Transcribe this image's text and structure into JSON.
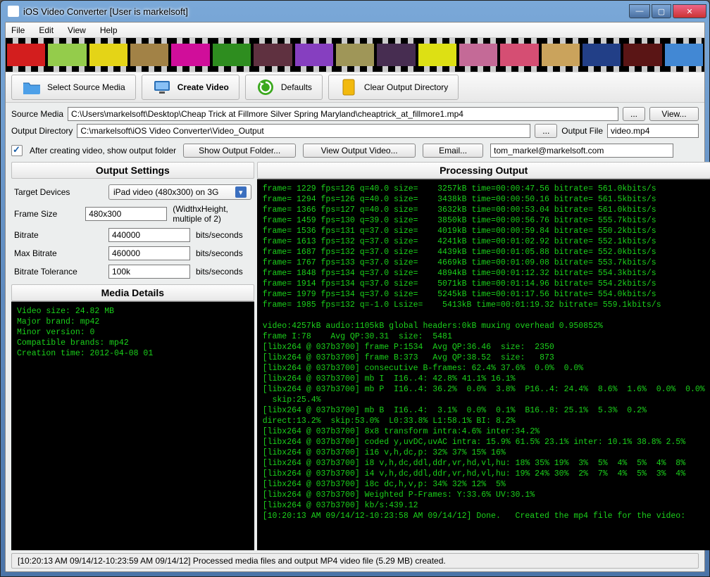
{
  "window": {
    "title": "iOS Video Converter [User is markelsoft]"
  },
  "menu": {
    "file": "File",
    "edit": "Edit",
    "view": "View",
    "help": "Help"
  },
  "toolbar": {
    "select_source": "Select Source Media",
    "create_video": "Create Video",
    "defaults": "Defaults",
    "clear_output": "Clear Output Directory"
  },
  "paths": {
    "source_label": "Source Media",
    "source_value": "C:\\Users\\markelsoft\\Desktop\\Cheap Trick at Fillmore Silver Spring Maryland\\cheaptrick_at_fillmore1.mp4",
    "browse": "...",
    "view_btn": "View...",
    "output_dir_label": "Output Directory",
    "output_dir_value": "C:\\markelsoft\\iOS Video Converter\\Video_Output",
    "output_file_label": "Output File",
    "output_file_value": "video.mp4"
  },
  "options": {
    "show_folder_ck": "After creating video, show output folder",
    "show_output_folder_btn": "Show Output Folder...",
    "view_output_video_btn": "View Output Video...",
    "email_btn": "Email...",
    "email_value": "tom_markel@markelsoft.com"
  },
  "settings": {
    "header": "Output Settings",
    "target_label": "Target Devices",
    "target_value": "iPad video (480x300) on 3G",
    "frame_label": "Frame Size",
    "frame_value": "480x300",
    "frame_unit": "(WidthxHeight, multiple of 2)",
    "bitrate_label": "Bitrate",
    "bitrate_value": "440000",
    "bitrate_unit": "bits/seconds",
    "maxbitrate_label": "Max Bitrate",
    "maxbitrate_value": "460000",
    "maxbitrate_unit": "bits/seconds",
    "bittol_label": "Bitrate Tolerance",
    "bittol_value": "100k",
    "bittol_unit": "bits/seconds"
  },
  "media": {
    "header": "Media Details",
    "lines": "Video size: 24.82 MB\nMajor brand: mp42\nMinor version: 0\nCompatible brands: mp42\nCreation time: 2012-04-08 01"
  },
  "processing": {
    "header": "Processing Output",
    "lines": "frame= 1229 fps=126 q=40.0 size=    3257kB time=00:00:47.56 bitrate= 561.0kbits/s\nframe= 1294 fps=126 q=40.0 size=    3438kB time=00:00:50.16 bitrate= 561.5kbits/s\nframe= 1366 fps=127 q=40.0 size=    3632kB time=00:00:53.04 bitrate= 561.0kbits/s\nframe= 1459 fps=130 q=39.0 size=    3850kB time=00:00:56.76 bitrate= 555.7kbits/s\nframe= 1536 fps=131 q=37.0 size=    4019kB time=00:00:59.84 bitrate= 550.2kbits/s\nframe= 1613 fps=132 q=37.0 size=    4241kB time=00:01:02.92 bitrate= 552.1kbits/s\nframe= 1687 fps=132 q=37.0 size=    4439kB time=00:01:05.88 bitrate= 552.0kbits/s\nframe= 1767 fps=133 q=37.0 size=    4669kB time=00:01:09.08 bitrate= 553.7kbits/s\nframe= 1848 fps=134 q=37.0 size=    4894kB time=00:01:12.32 bitrate= 554.3kbits/s\nframe= 1914 fps=134 q=37.0 size=    5071kB time=00:01:14.96 bitrate= 554.2kbits/s\nframe= 1979 fps=134 q=37.0 size=    5245kB time=00:01:17.56 bitrate= 554.0kbits/s\nframe= 1985 fps=132 q=-1.0 Lsize=    5413kB time=00:01:19.32 bitrate= 559.1kbits/s\n\nvideo:4257kB audio:1105kB global headers:0kB muxing overhead 0.950852%\nframe I:78    Avg QP:30.31  size:  5481\n[libx264 @ 037b3700] frame P:1534  Avg QP:36.46  size:  2350\n[libx264 @ 037b3700] frame B:373   Avg QP:38.52  size:   873\n[libx264 @ 037b3700] consecutive B-frames: 62.4% 37.6%  0.0%  0.0%\n[libx264 @ 037b3700] mb I  I16..4: 42.8% 41.1% 16.1%\n[libx264 @ 037b3700] mb P  I16..4: 36.2%  0.0%  3.8%  P16..4: 24.4%  8.6%  1.6%  0.0%  0.0%\n  skip:25.4%\n[libx264 @ 037b3700] mb B  I16..4:  3.1%  0.0%  0.1%  B16..8: 25.1%  5.3%  0.2%\ndirect:13.2%  skip:53.0%  L0:33.8% L1:58.1% BI: 8.2%\n[libx264 @ 037b3700] 8x8 transform intra:4.6% inter:34.2%\n[libx264 @ 037b3700] coded y,uvDC,uvAC intra: 15.9% 61.5% 23.1% inter: 10.1% 38.8% 2.5%\n[libx264 @ 037b3700] i16 v,h,dc,p: 32% 37% 15% 16%\n[libx264 @ 037b3700] i8 v,h,dc,ddl,ddr,vr,hd,vl,hu: 18% 35% 19%  3%  5%  4%  5%  4%  8%\n[libx264 @ 037b3700] i4 v,h,dc,ddl,ddr,vr,hd,vl,hu: 19% 24% 30%  2%  7%  4%  5%  3%  4%\n[libx264 @ 037b3700] i8c dc,h,v,p: 34% 32% 12%  5%\n[libx264 @ 037b3700] Weighted P-Frames: Y:33.6% UV:30.1%\n[libx264 @ 037b3700] kb/s:439.12\n[10:20:13 AM 09/14/12-10:23:58 AM 09/14/12] Done.   Created the mp4 file for the video:"
  },
  "status": {
    "text": "[10:20:13 AM 09/14/12-10:23:59 AM 09/14/12] Processed media files and output MP4 video file  (5.29 MB) created."
  },
  "filmstrip_colors": [
    "#d31e1e",
    "#94cc4b",
    "#e4d417",
    "#a28246",
    "#d00e9a",
    "#2e8d1f",
    "#5f3140",
    "#863fc0",
    "#9f9658",
    "#472d51",
    "#dde014",
    "#c46a97",
    "#d54e73",
    "#caa35c",
    "#223f87",
    "#5a1515",
    "#4288d4"
  ]
}
